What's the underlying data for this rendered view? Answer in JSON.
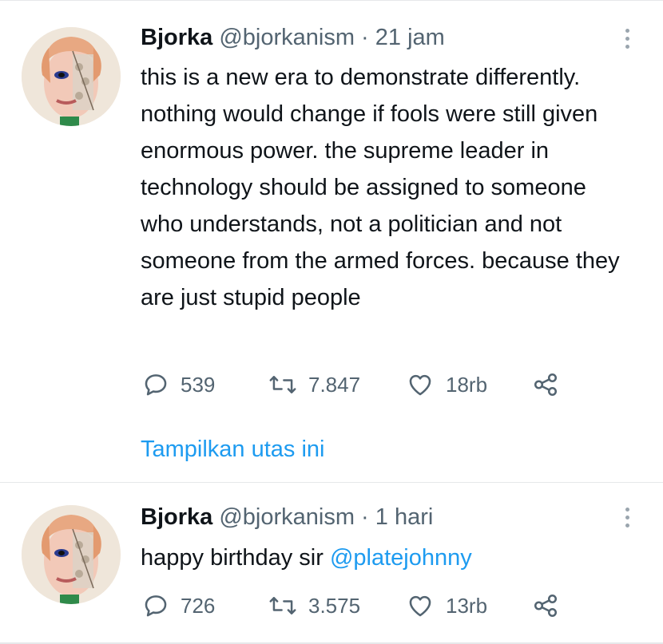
{
  "tweets": [
    {
      "name": "Bjorka",
      "handle": "@bjorkanism",
      "separator": "·",
      "time": "21 jam",
      "text": "this is a new era to demonstrate differently. nothing would change if fools were still given enormous power. the supreme leader in technology should be assigned to someone who understands, not a politician and not someone from the armed forces. because they are just stupid people",
      "replies": "539",
      "retweets": "7.847",
      "likes": "18rb",
      "thread_link": "Tampilkan utas ini"
    },
    {
      "name": "Bjorka",
      "handle": "@bjorkanism",
      "separator": "·",
      "time": "1 hari",
      "text": "happy birthday sir ",
      "mention": "@platejohnny",
      "replies": "726",
      "retweets": "3.575",
      "likes": "13rb"
    }
  ],
  "colors": {
    "text": "#0f1419",
    "secondary": "#536471",
    "link": "#1d9bf0",
    "divider": "#e6e8ea"
  },
  "icons": [
    "avatar-image",
    "more-options-icon",
    "reply-icon",
    "retweet-icon",
    "like-icon",
    "share-icon"
  ]
}
